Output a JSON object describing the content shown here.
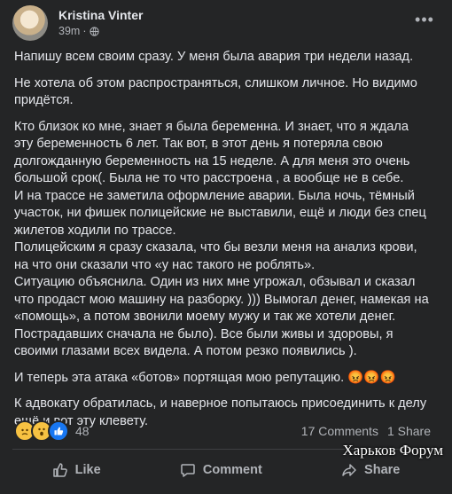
{
  "post": {
    "author": "Kristina Vinter",
    "time": "39m",
    "privacy_icon": "globe-icon",
    "paragraphs": [
      "Напишу всем своим сразу. У меня была авария три недели назад.",
      "Не хотела об этом распространяться, слишком личное. Но видимо придётся.",
      "Кто близок ко мне, знает я была беременна. И знает, что я ждала эту беременность 6 лет. Так вот, в этот день я потеряла свою долгожданную беременность на 15 неделе. А для меня это очень большой срок(. Была не то что расстроена , а вообще не в себе.\n И на трассе не заметила оформление аварии. Была ночь, тёмный участок, ни фишек полицейские не выставили, ещё и люди без спец жилетов ходили по трассе.\nПолицейским я сразу сказала, что бы везли меня на анализ крови, на что они сказали что «у нас такого не роблять».\nСитуацию объяснила. Один из них мне угрожал, обзывал и сказал что продаст мою машину на разборку. ))) Вымогал денег, намекая на «помощь», а потом звонили моему мужу и так же хотели денег. Пострадавших сначала не было). Все были живы и здоровы, я своими глазами всех видела. А потом резко появились ).",
      "И теперь эта атака «ботов» портящая мою репутацию. 😡😡😡",
      "К адвокату обратилась, и наверное попытаюсь присоединить к делу ещё и вот эту клевету."
    ]
  },
  "reactions": {
    "icons": [
      "sad-reaction",
      "wow-reaction",
      "like-reaction"
    ],
    "count": "48"
  },
  "stats": {
    "comments": "17 Comments",
    "shares": "1 Share"
  },
  "actions": {
    "like": "Like",
    "comment": "Comment",
    "share": "Share"
  },
  "watermark": "Харьков Форум"
}
